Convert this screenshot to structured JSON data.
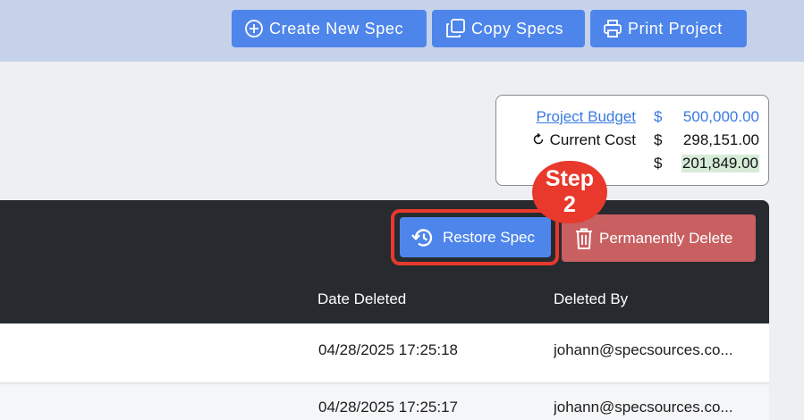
{
  "toolbar": {
    "create_label": "Create New Spec",
    "copy_label": "Copy Specs",
    "print_label": "Print Project"
  },
  "budget": {
    "budget_label": "Project Budget",
    "budget_currency": "$",
    "budget_value": "500,000.00",
    "cost_label": "Current Cost",
    "cost_currency": "$",
    "cost_value": "298,151.00",
    "remaining_currency": "$",
    "remaining_value": "201,849.00"
  },
  "annotation": {
    "step_word": "Step",
    "step_number": "2"
  },
  "actions": {
    "restore_label": "Restore Spec",
    "delete_label": "Permanently Delete"
  },
  "table": {
    "columns": [
      "Date Deleted",
      "Deleted By"
    ],
    "rows": [
      {
        "date_deleted": "04/28/2025 17:25:18",
        "deleted_by": "johann@specsources.co..."
      },
      {
        "date_deleted": "04/28/2025 17:25:17",
        "deleted_by": "johann@specsources.co..."
      }
    ]
  },
  "colors": {
    "primary": "#4e85ea",
    "danger": "#c85f61",
    "annotation": "#e8392c",
    "header_dark": "#272b30"
  }
}
